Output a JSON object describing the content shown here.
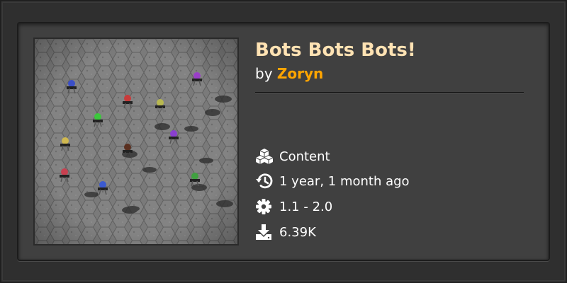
{
  "mod": {
    "title": "Bots Bots Bots!",
    "by_label": "by",
    "author": "Zoryn",
    "category": "Content",
    "updated": "1 year, 1 month ago",
    "factorio_version": "1.1 - 2.0",
    "downloads": "6.39K"
  },
  "icons": {
    "category": "cubes-icon",
    "updated": "history-icon",
    "version": "gear-icon",
    "downloads": "download-icon"
  },
  "colors": {
    "title": "#ffe2b3",
    "author": "#ffa500",
    "text": "#ffffff",
    "card_bg": "#404040",
    "page_bg": "#2f2f2f"
  }
}
